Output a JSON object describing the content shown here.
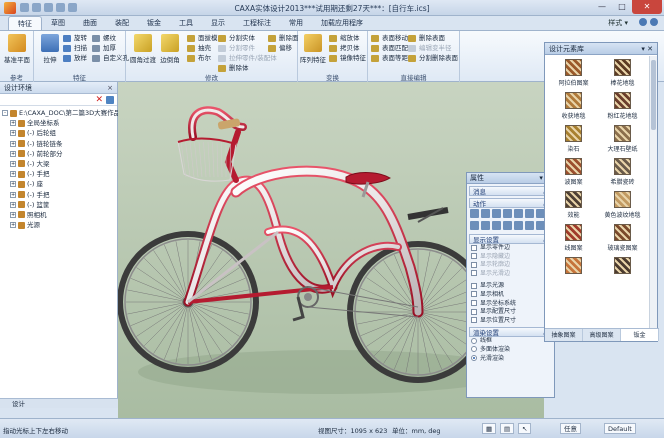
{
  "window": {
    "title": "CAXA实体设计2013***试用期还剩27天***：[自行车.ics]",
    "controls": [
      "—",
      "□",
      "✕"
    ]
  },
  "ribbon": {
    "tabs": [
      "特征",
      "草图",
      "曲面",
      "装配",
      "钣金",
      "工具",
      "显示",
      "工程标注",
      "常用",
      "加载应用程序"
    ],
    "active_tab": "特征",
    "style_menu": "样式 ▾",
    "groups": {
      "reference": {
        "label": "参考",
        "big": [
          "基准平面"
        ]
      },
      "feature": {
        "label": "特征",
        "big": [
          "拉伸"
        ],
        "small": [
          "旋转",
          "扫描",
          "放样",
          "螺纹",
          "加厚",
          "自定义孔"
        ]
      },
      "modify": {
        "label": "修改",
        "big": [
          "圆角过渡",
          "边倒角"
        ],
        "small": [
          "面拔模",
          "抽壳",
          "布尔",
          "分割实体",
          "分割零件",
          "拉伸零件/装配体",
          "删除体",
          "删除面",
          "偏移"
        ]
      },
      "transform": {
        "label": "变换",
        "big": [
          "阵列特征"
        ],
        "small": [
          "缩放体",
          "拷贝体",
          "镜像特征"
        ]
      },
      "direct_edit": {
        "label": "直接编辑",
        "small": [
          "表面移动",
          "表面匹配",
          "表面等距",
          "删除表面",
          "编辑变半径",
          "分割删除表面"
        ]
      }
    }
  },
  "design_env": {
    "title": "设计环境",
    "close": "×",
    "tree": [
      {
        "label": "E:\\CAXA_DOC\\第二篇3D大赛作品",
        "level": 0,
        "expander": "-"
      },
      {
        "label": "全局坐标系",
        "level": 1,
        "expander": "+"
      },
      {
        "label": "(-) 后轮组",
        "level": 1,
        "expander": "+"
      },
      {
        "label": "(-) 链轮链条",
        "level": 1,
        "expander": "+"
      },
      {
        "label": "(-) 前轮部分",
        "level": 1,
        "expander": "+"
      },
      {
        "label": "(-) 大梁",
        "level": 1,
        "expander": "+"
      },
      {
        "label": "(-) 手把",
        "level": 1,
        "expander": "+"
      },
      {
        "label": "(-) 座",
        "level": 1,
        "expander": "+"
      },
      {
        "label": "(-) 手把",
        "level": 1,
        "expander": "+"
      },
      {
        "label": "(-) 篮筐",
        "level": 1,
        "expander": "+"
      },
      {
        "label": "照相机",
        "level": 1,
        "expander": "+"
      },
      {
        "label": "光源",
        "level": 1,
        "expander": "+"
      }
    ],
    "bottom_tab": "设计"
  },
  "properties": {
    "title": "属性",
    "sections": {
      "message": "消息",
      "actions": "动作",
      "display": "显示设置",
      "render": "渲染设置"
    },
    "display_options": [
      {
        "label": "显示零件边",
        "dim": false
      },
      {
        "label": "显示隐藏边",
        "dim": true
      },
      {
        "label": "显示轮廓边",
        "dim": true
      },
      {
        "label": "显示光滑边",
        "dim": true
      },
      {
        "label": "显示光源",
        "dim": false
      },
      {
        "label": "显示相机",
        "dim": false
      },
      {
        "label": "显示坐标系统",
        "dim": false
      },
      {
        "label": "显示配置尺寸",
        "dim": false
      },
      {
        "label": "显示位置尺寸",
        "dim": false
      }
    ],
    "render_options": [
      {
        "label": "线框",
        "selected": false
      },
      {
        "label": "多面体渲染",
        "selected": false
      },
      {
        "label": "光滑渲染",
        "selected": true
      }
    ]
  },
  "library": {
    "title": "设计元素库",
    "items": [
      {
        "label": "阿拉伯图案",
        "color": "#9b5a2a"
      },
      {
        "label": "棒花地毯",
        "color": "#5c3a22"
      },
      {
        "label": "收获地毯",
        "color": "#b07a3a"
      },
      {
        "label": "粉红花地毯",
        "color": "#6b3d2b"
      },
      {
        "label": "染石",
        "color": "#a8802f"
      },
      {
        "label": "大理石壁纸",
        "color": "#8c6f4c"
      },
      {
        "label": "波图案",
        "color": "#9c4f2e"
      },
      {
        "label": "希腊瓷砖",
        "color": "#6a5b4a"
      },
      {
        "label": "效能",
        "color": "#4f4034"
      },
      {
        "label": "黄色波纹地毯",
        "color": "#c29a61"
      },
      {
        "label": "线图案",
        "color": "#a03b2a"
      },
      {
        "label": "玻璃瓷图案",
        "color": "#7b4a2b"
      },
      {
        "label": "",
        "color": "#c6743a"
      },
      {
        "label": "",
        "color": "#4b3b2f"
      }
    ],
    "tabs": [
      "抽象图案",
      "高级图案",
      "钣金"
    ]
  },
  "status": {
    "hint": "指动光标上下左右移动",
    "view_size": "视图尺寸：1095 x 623",
    "units": "单位：mm, deg",
    "tolerance": "任意",
    "style": "Default"
  }
}
